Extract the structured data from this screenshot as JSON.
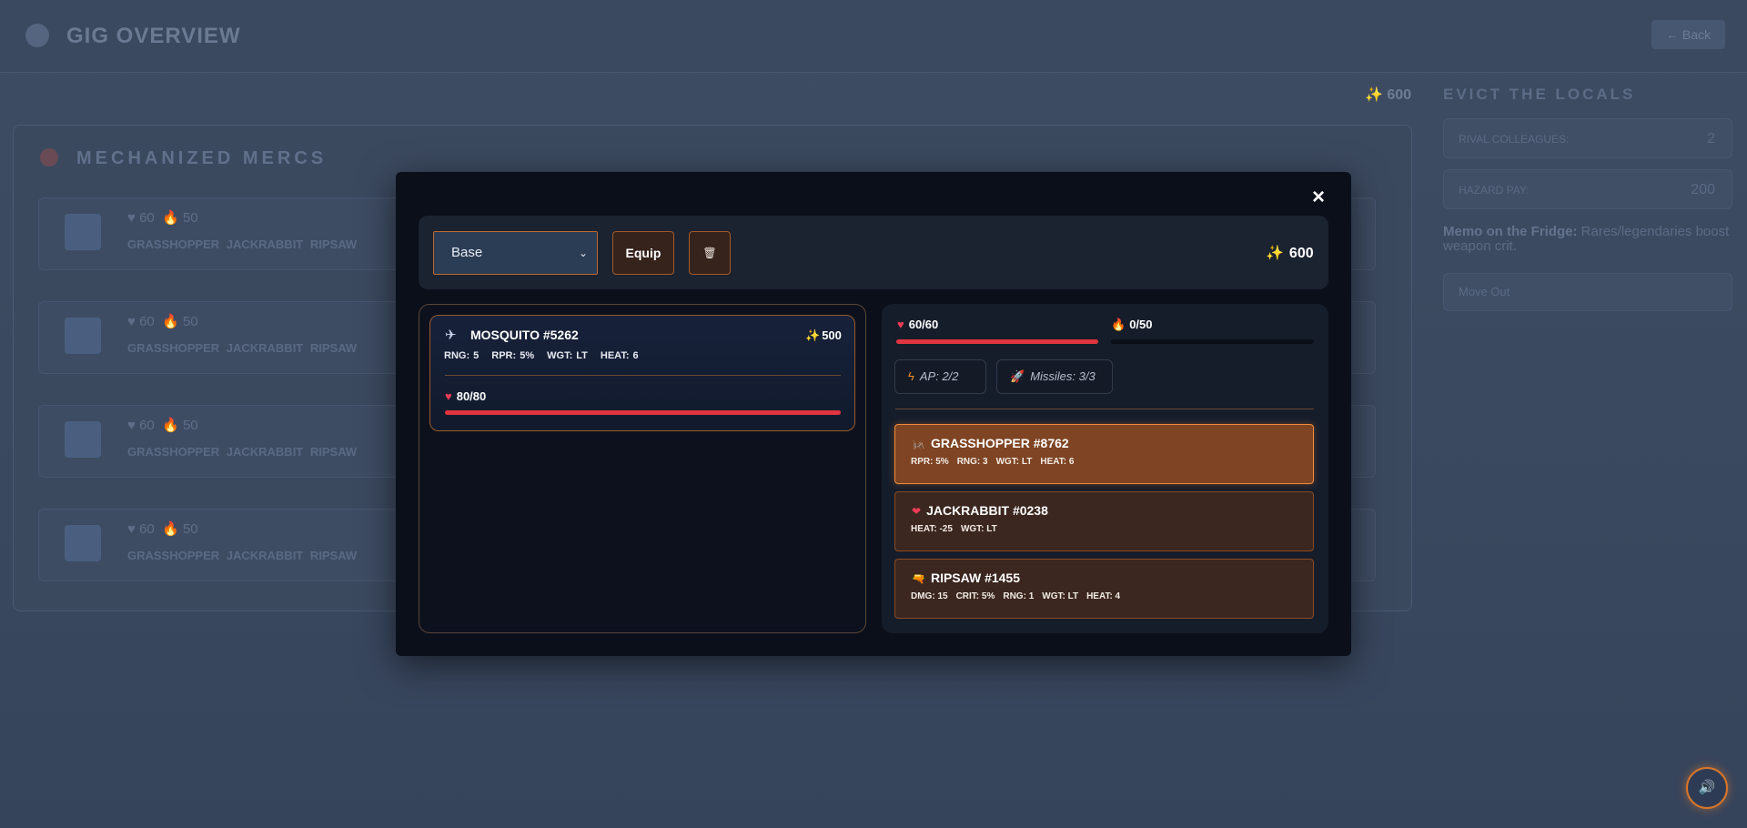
{
  "background": {
    "app_title": "GIG OVERVIEW",
    "back_label": "← Back",
    "credits": "✨ 600",
    "section_title": "MECHANIZED MERCS",
    "merc_rows": [
      {
        "hp": "60",
        "heat": "50",
        "parts": "GRASSHOPPER JACKRABBIT RIPSAW"
      },
      {
        "hp": "60",
        "heat": "50",
        "parts": "GRASSHOPPER JACKRABBIT RIPSAW"
      },
      {
        "hp": "60",
        "heat": "50",
        "parts": "GRASSHOPPER JACKRABBIT RIPSAW"
      },
      {
        "hp": "60",
        "heat": "50",
        "parts": "GRASSHOPPER JACKRABBIT RIPSAW"
      }
    ],
    "side_title": "EVICT THE LOCALS",
    "side_stats": [
      {
        "label": "RIVAL COLLEAGUES:",
        "value": "2"
      },
      {
        "label": "HAZARD PAY:",
        "value": "200"
      }
    ],
    "memo_label": "Memo on the Fridge:",
    "memo_text": "Rares/legendaries boost weapon crit.",
    "move_out_label": "Move Out"
  },
  "modal": {
    "close_label": "×",
    "select_value": "Base",
    "equip_label": "Equip",
    "trash_icon": "🗑",
    "credits": "600",
    "mech": {
      "icon": "✈",
      "name": "MOSQUITO #5262",
      "cost": "500",
      "stats": [
        "RNG: 5",
        "RPR: 5%",
        "WGT: LT",
        "HEAT: 6"
      ],
      "hp_label": "80/80",
      "hp_fraction": 1.0
    },
    "status": {
      "hp_label": "60/60",
      "hp_fraction": 1.0,
      "heat_label": "0/50",
      "heat_fraction": 0.0,
      "ap_label": "AP: 2/2",
      "missiles_label": "Missiles: 3/3"
    },
    "parts": [
      {
        "icon": "🦗",
        "name": "GRASSHOPPER #8762",
        "stats": [
          "RPR: 5%",
          "RNG: 3",
          "WGT: LT",
          "HEAT: 6"
        ],
        "selected": true
      },
      {
        "icon": "❤",
        "name": "JACKRABBIT #0238",
        "stats": [
          "HEAT: -25",
          "WGT: LT"
        ],
        "selected": false
      },
      {
        "icon": "🔫",
        "name": "RIPSAW #1455",
        "stats": [
          "DMG: 15",
          "CRIT: 5%",
          "RNG: 1",
          "WGT: LT",
          "HEAT: 4"
        ],
        "selected": false
      }
    ]
  },
  "sound_icon": "🔊",
  "colors": {
    "accent": "#f08b3a",
    "hp": "#e0343f",
    "heat": "#f28c28",
    "modal_bg": "#0b0f1a"
  }
}
